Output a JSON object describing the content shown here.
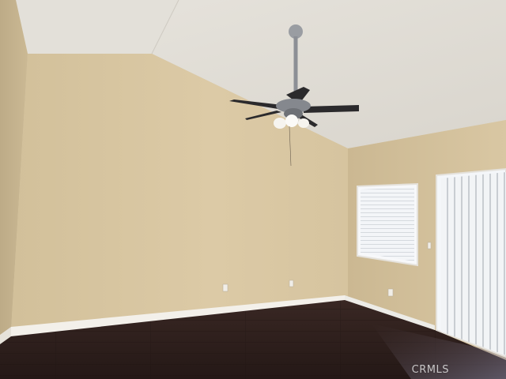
{
  "watermark": {
    "text": "CRMLS"
  },
  "colors": {
    "ceiling": "#ebe8e2",
    "wall_main": "#d8c7a2",
    "wall_right": "#d4c19d",
    "wall_left": "#c7b591",
    "floor": "#2e1f1c",
    "baseboard": "#f3f0ea",
    "fan_metal": "#8c8f95",
    "fan_blade": "#2b2a2c",
    "window_glass": "#f4f6fa"
  }
}
